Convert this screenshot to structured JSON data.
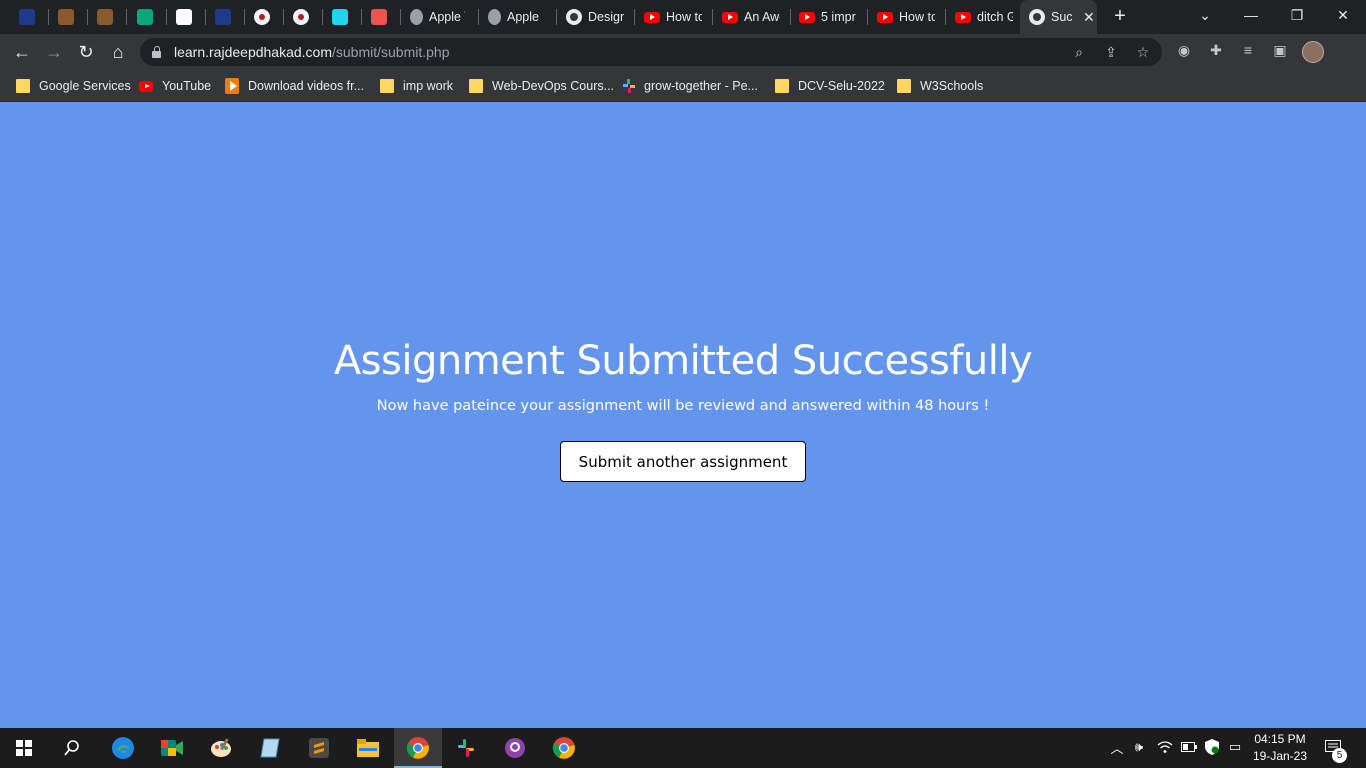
{
  "browser": {
    "tabs": [
      {
        "label": "",
        "icon": "app-icon-blue",
        "color": "#1e3a8a"
      },
      {
        "label": "",
        "icon": "bookmark-app-icon-brown",
        "color": "#8b5a2b"
      },
      {
        "label": "",
        "icon": "bookmark-app-icon-brown",
        "color": "#8b5a2b"
      },
      {
        "label": "",
        "icon": "w-app-icon",
        "color": "#0ca678"
      },
      {
        "label": "",
        "icon": "calendar-icon",
        "color": "#ffffff"
      },
      {
        "label": "",
        "icon": "app-icon-blue",
        "color": "#1e3a8a"
      },
      {
        "label": "",
        "icon": "avatar-icon",
        "color": "#f5f5f5"
      },
      {
        "label": "",
        "icon": "avatar-icon",
        "color": "#f5f5f5"
      },
      {
        "label": "",
        "icon": "cube-icon",
        "color": "#22d3ee"
      },
      {
        "label": "",
        "icon": "robot-icon",
        "color": "#ef5350"
      },
      {
        "label": "Apple \\",
        "icon": "apple-icon",
        "color": "#9e9e9e"
      },
      {
        "label": "Apple (",
        "icon": "apple-icon",
        "color": "#9e9e9e"
      },
      {
        "label": "Design",
        "icon": "globe-icon",
        "color": "#e8eaed"
      },
      {
        "label": "How to",
        "icon": "youtube-icon",
        "color": "#ff0000"
      },
      {
        "label": "An Awe",
        "icon": "youtube-icon",
        "color": "#ff0000"
      },
      {
        "label": "5 impr",
        "icon": "youtube-icon",
        "color": "#ff0000"
      },
      {
        "label": "How to",
        "icon": "youtube-icon",
        "color": "#ff0000"
      },
      {
        "label": "ditch G",
        "icon": "youtube-icon",
        "color": "#ff0000"
      },
      {
        "label": "Suc",
        "icon": "globe-icon",
        "color": "#e8eaed",
        "active": true
      }
    ],
    "url_host": "learn.rajdeepdhakad.com",
    "url_path": "/submit/submit.php",
    "bookmarks": [
      {
        "label": "Google Services",
        "icon": "folder-icon"
      },
      {
        "label": "YouTube",
        "icon": "youtube-icon"
      },
      {
        "label": "Download videos fr...",
        "icon": "download-icon"
      },
      {
        "label": "imp work",
        "icon": "folder-icon"
      },
      {
        "label": "Web-DevOps Cours...",
        "icon": "folder-icon"
      },
      {
        "label": "grow-together - Pe...",
        "icon": "slack-icon"
      },
      {
        "label": "DCV-Selu-2022",
        "icon": "folder-icon"
      },
      {
        "label": "W3Schools",
        "icon": "folder-icon"
      }
    ]
  },
  "page": {
    "heading": "Assignment Submitted Successfully",
    "subtext": "Now have pateince your assignment will be reviewd and answered within 48 hours !",
    "button_label": "Submit another assignment",
    "background_color": "#6495ed"
  },
  "taskbar": {
    "time": "04:15 PM",
    "date": "19-Jan-23",
    "notification_count": "5"
  }
}
